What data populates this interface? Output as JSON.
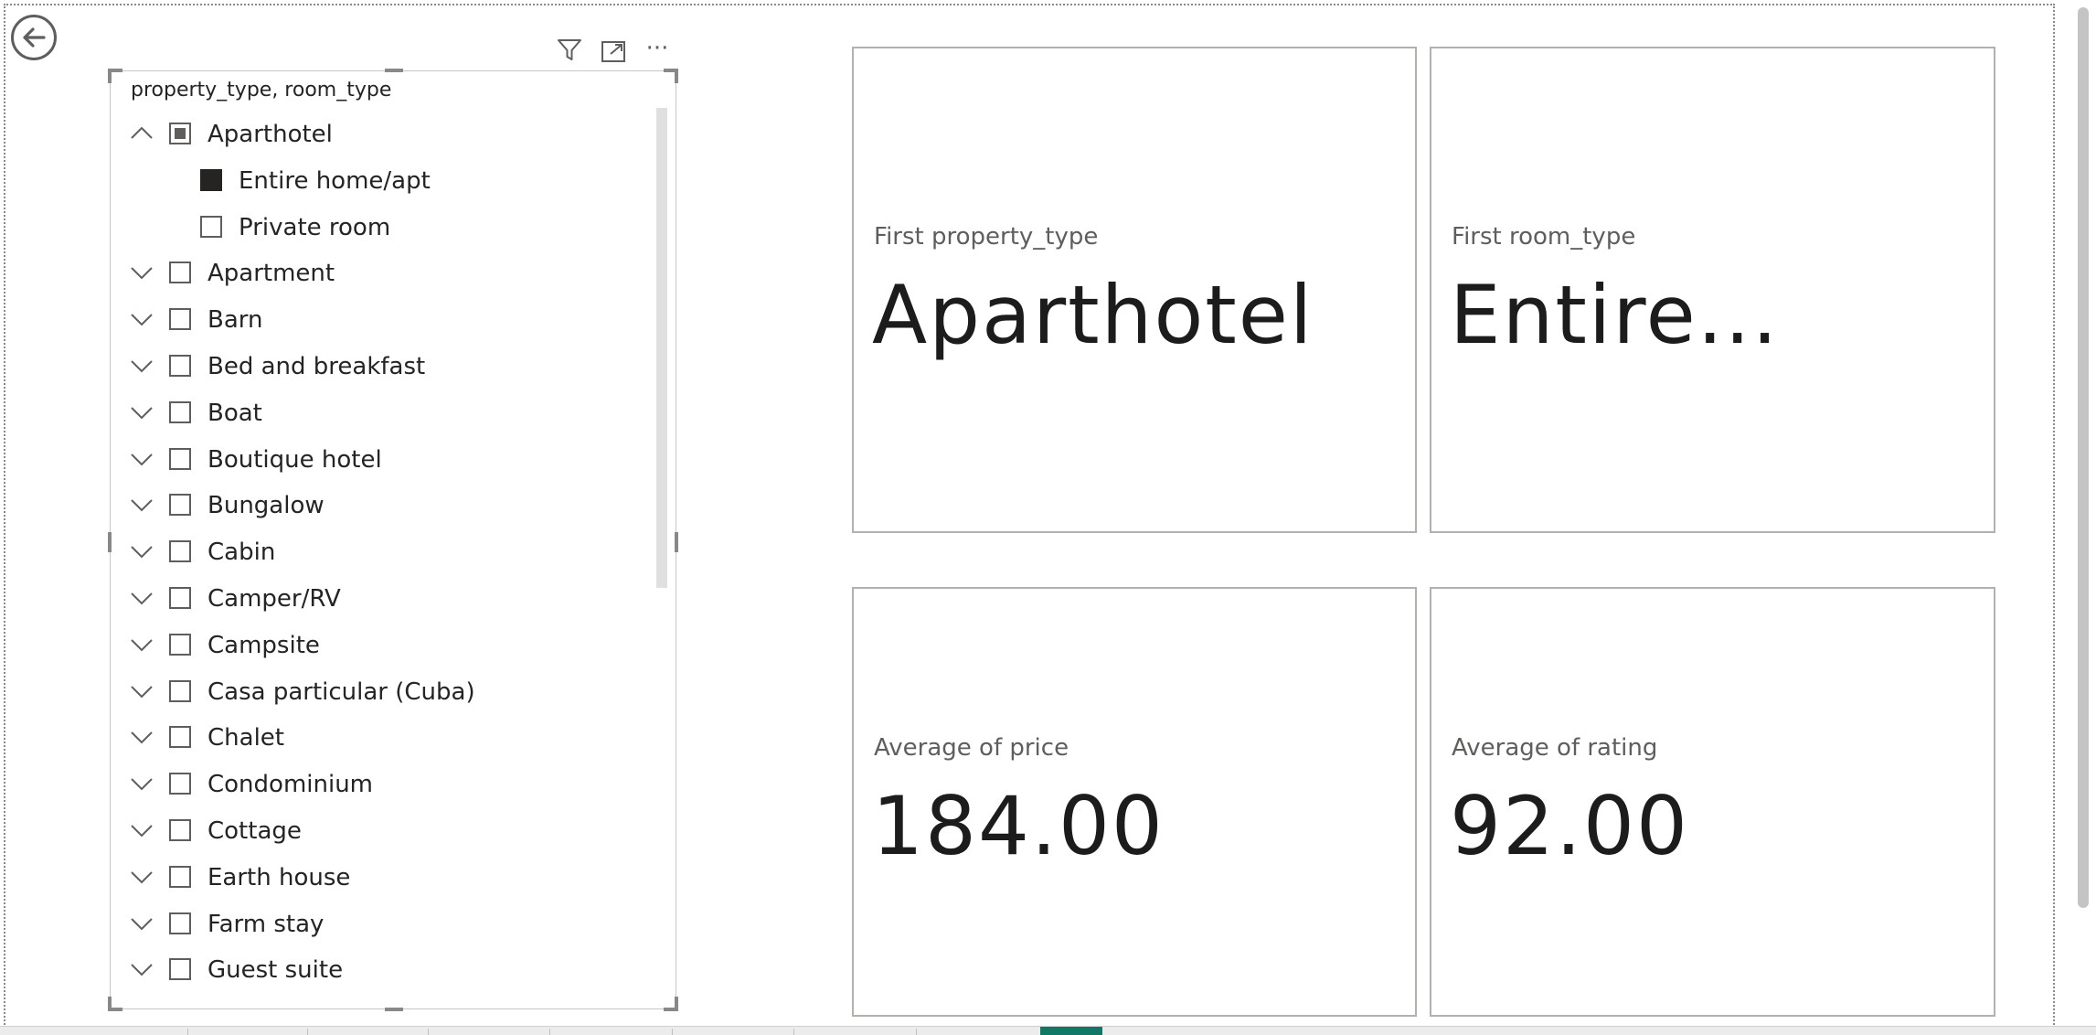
{
  "navigation": {
    "back_icon": "arrow-left-circle-icon"
  },
  "slicer": {
    "title": "property_type, room_type",
    "toolbar_icons": [
      "filter-icon",
      "focus-mode-icon",
      "more-options-icon"
    ],
    "toolbar_more_label": "···",
    "items": [
      {
        "label": "Aparthotel",
        "level": 0,
        "expanded": true,
        "state": "partial"
      },
      {
        "label": "Entire home/apt",
        "level": 1,
        "state": "checked"
      },
      {
        "label": "Private room",
        "level": 1,
        "state": "unchecked"
      },
      {
        "label": "Apartment",
        "level": 0,
        "expanded": false,
        "state": "unchecked"
      },
      {
        "label": "Barn",
        "level": 0,
        "expanded": false,
        "state": "unchecked"
      },
      {
        "label": "Bed and breakfast",
        "level": 0,
        "expanded": false,
        "state": "unchecked"
      },
      {
        "label": "Boat",
        "level": 0,
        "expanded": false,
        "state": "unchecked"
      },
      {
        "label": "Boutique hotel",
        "level": 0,
        "expanded": false,
        "state": "unchecked"
      },
      {
        "label": "Bungalow",
        "level": 0,
        "expanded": false,
        "state": "unchecked"
      },
      {
        "label": "Cabin",
        "level": 0,
        "expanded": false,
        "state": "unchecked"
      },
      {
        "label": "Camper/RV",
        "level": 0,
        "expanded": false,
        "state": "unchecked"
      },
      {
        "label": "Campsite",
        "level": 0,
        "expanded": false,
        "state": "unchecked"
      },
      {
        "label": "Casa particular (Cuba)",
        "level": 0,
        "expanded": false,
        "state": "unchecked"
      },
      {
        "label": "Chalet",
        "level": 0,
        "expanded": false,
        "state": "unchecked"
      },
      {
        "label": "Condominium",
        "level": 0,
        "expanded": false,
        "state": "unchecked"
      },
      {
        "label": "Cottage",
        "level": 0,
        "expanded": false,
        "state": "unchecked"
      },
      {
        "label": "Earth house",
        "level": 0,
        "expanded": false,
        "state": "unchecked"
      },
      {
        "label": "Farm stay",
        "level": 0,
        "expanded": false,
        "state": "unchecked"
      },
      {
        "label": "Guest suite",
        "level": 0,
        "expanded": false,
        "state": "unchecked"
      }
    ]
  },
  "cards": [
    {
      "category": "First property_type",
      "value": "Aparthotel"
    },
    {
      "category": "First room_type",
      "value": "Entire..."
    },
    {
      "category": "Average of price",
      "value": "184.00"
    },
    {
      "category": "Average of rating",
      "value": "92.00"
    }
  ],
  "colors": {
    "accent_tab": "#117865",
    "text": "#252423",
    "muted": "#605e5c"
  }
}
